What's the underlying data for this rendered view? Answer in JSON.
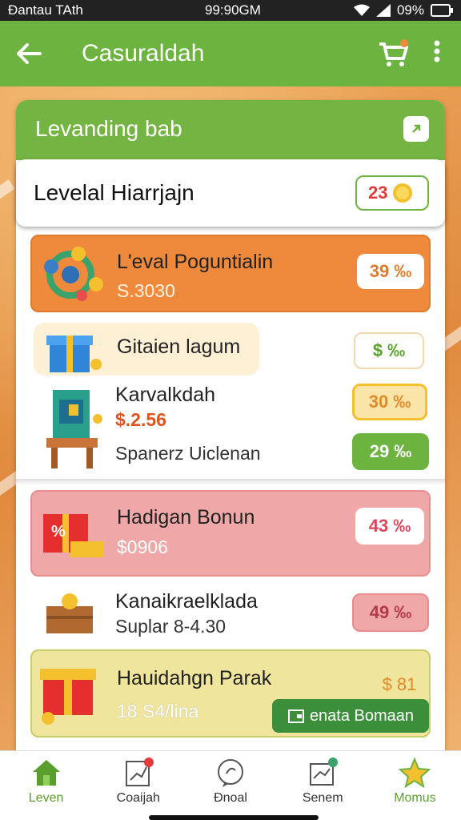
{
  "status": {
    "left": "Đantau TAth",
    "center": "99:90GM",
    "battery": "09%"
  },
  "appbar": {
    "title": "Casuraldah",
    "back_icon": "arrow-left-icon",
    "cart_icon": "cart-icon",
    "more_icon": "more-vert-icon"
  },
  "panel": {
    "header": "Levanding bab"
  },
  "highlight": {
    "title": "Levelal Hiarrjajn",
    "badge": "23"
  },
  "items": [
    {
      "title": "L'eval Poguntialin",
      "sub": "S.3030",
      "badge": "39 ‰",
      "color": "#ef8a3c"
    },
    {
      "title": "Gitaien lagum",
      "badge": "$ ‰"
    },
    {
      "title": "Karvalkdah",
      "sub": "$.2.56",
      "badge": "30 ‰"
    },
    {
      "title": "Spanerz Uiclenan",
      "badge": "29 ‰"
    },
    {
      "title": "Hadigan Bonun",
      "sub": "$0906",
      "badge": "43 ‰",
      "color": "#f0a7a8"
    },
    {
      "title": "Kanaikraelklada",
      "sub": "Suplar 8-4.30",
      "badge": "49 ‰"
    },
    {
      "title": "Hauidahgn Parak",
      "sub": "18 S4/lina",
      "badge": "$ 81",
      "button": "enata Bomaan"
    }
  ],
  "nav": [
    {
      "label": "Leven",
      "icon": "home-icon"
    },
    {
      "label": "Coaijah",
      "icon": "chart-icon"
    },
    {
      "label": "Đnoal",
      "icon": "chat-icon"
    },
    {
      "label": "Senem",
      "icon": "gift-icon"
    },
    {
      "label": "Momus",
      "icon": "star-icon"
    }
  ]
}
